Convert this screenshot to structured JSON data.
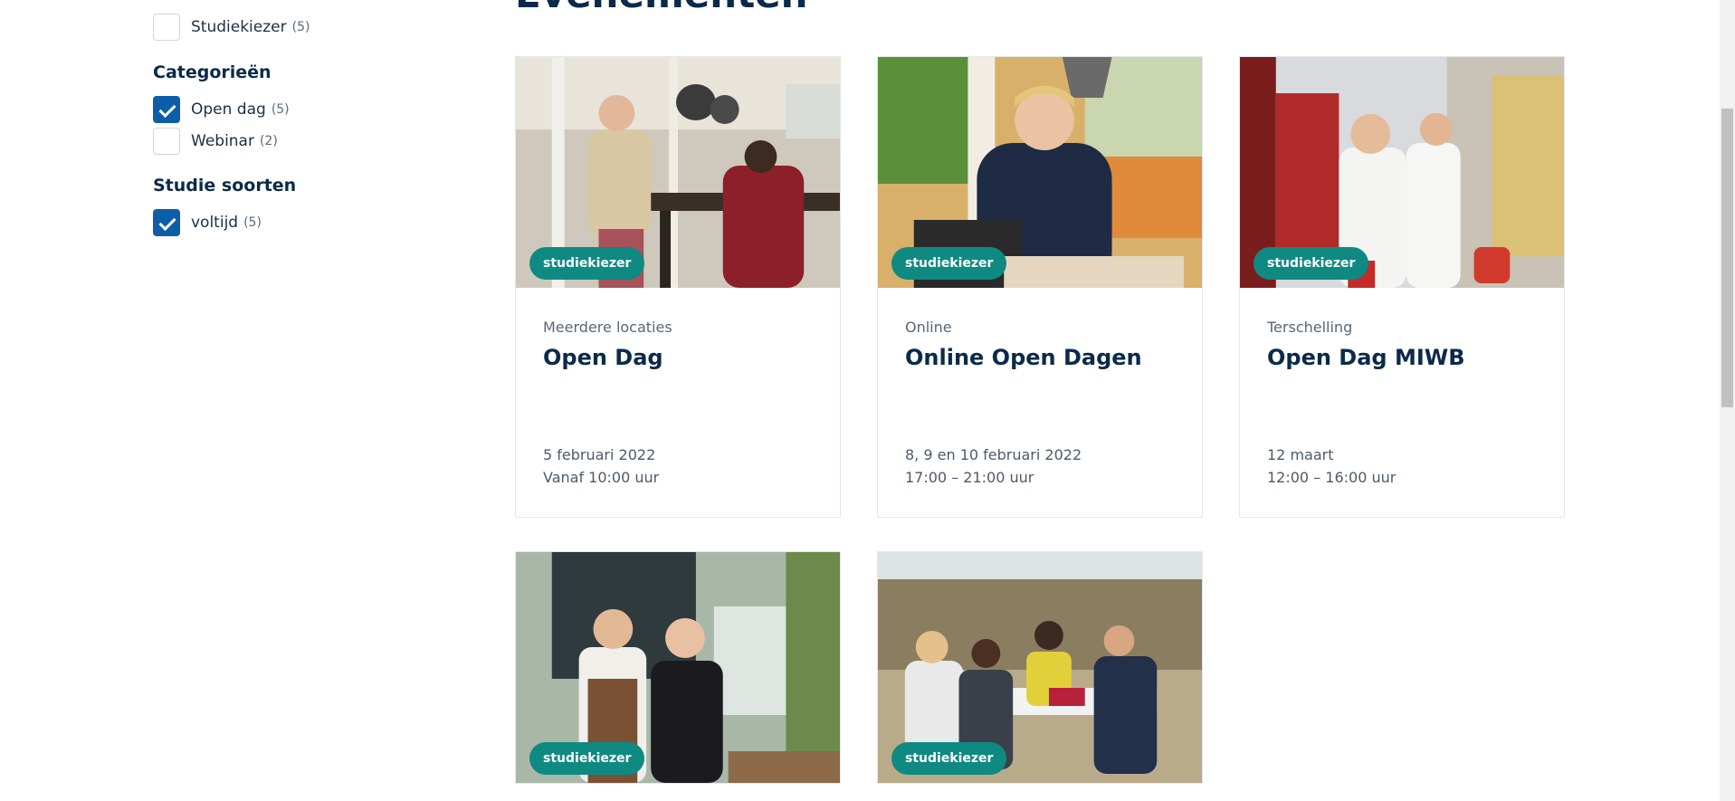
{
  "page_title": "Evenementen",
  "filters": {
    "top_item": {
      "label": "Studiekiezer",
      "count": "(5)",
      "checked": false
    },
    "categories": {
      "heading": "Categorieën",
      "items": [
        {
          "label": "Open dag",
          "count": "(5)",
          "checked": true
        },
        {
          "label": "Webinar",
          "count": "(2)",
          "checked": false
        }
      ]
    },
    "study_types": {
      "heading": "Studie soorten",
      "items": [
        {
          "label": "voltijd",
          "count": "(5)",
          "checked": true
        }
      ]
    }
  },
  "events": [
    {
      "badge": "studiekiezer",
      "location": "Meerdere locaties",
      "title": "Open Dag",
      "date_line1": "5 februari 2022",
      "date_line2": "Vanaf 10:00 uur"
    },
    {
      "badge": "studiekiezer",
      "location": "Online",
      "title": "Online Open Dagen",
      "date_line1": "8, 9 en 10 februari 2022",
      "date_line2": "17:00 – 21:00 uur"
    },
    {
      "badge": "studiekiezer",
      "location": "Terschelling",
      "title": "Open Dag MIWB",
      "date_line1": "12 maart",
      "date_line2": "12:00 – 16:00 uur"
    },
    {
      "badge": "studiekiezer"
    },
    {
      "badge": "studiekiezer"
    }
  ],
  "colors": {
    "brand_navy": "#0b2a4a",
    "checkbox_blue": "#0d5ea8",
    "badge_teal": "#0e8a82"
  }
}
